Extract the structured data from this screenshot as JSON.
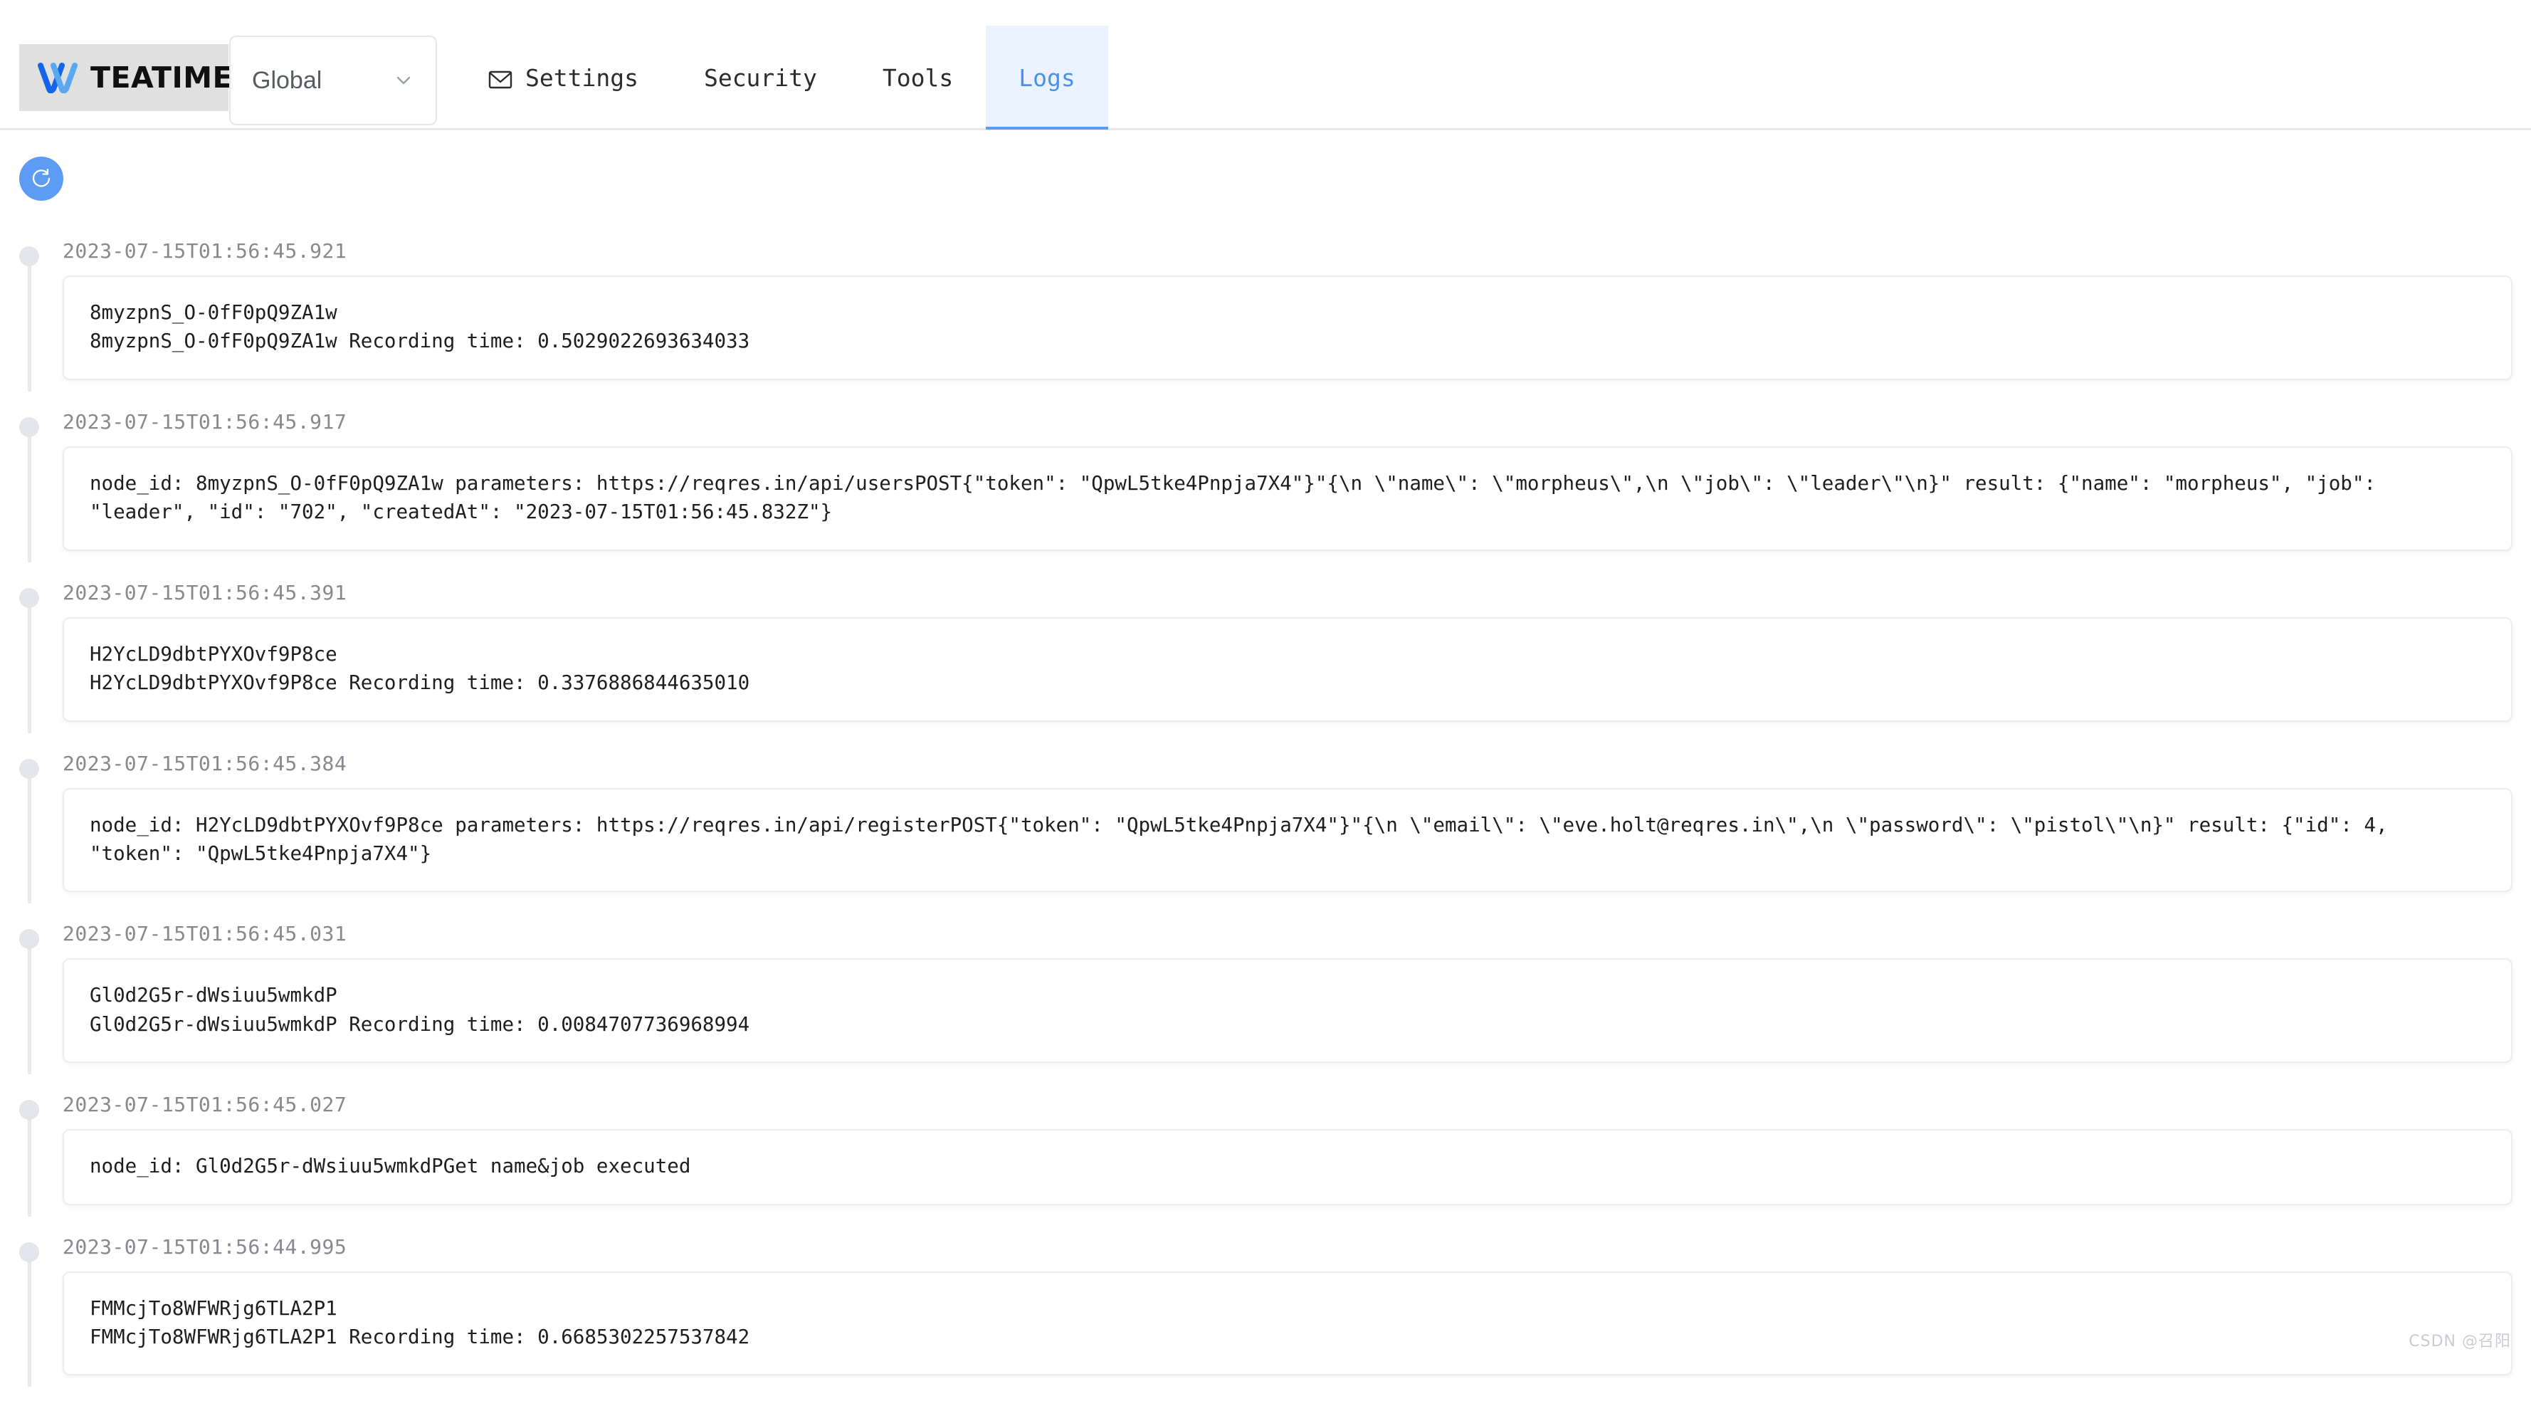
{
  "brand": {
    "name": "TEATIME",
    "logo_icon": "teatime-wave-logo"
  },
  "region_select": {
    "value": "Global",
    "chevron_icon": "chevron-down-icon"
  },
  "tabs": [
    {
      "label": "Settings",
      "icon": "envelope-icon",
      "active": false
    },
    {
      "label": "Security",
      "icon": "",
      "active": false
    },
    {
      "label": "Tools",
      "icon": "",
      "active": false
    },
    {
      "label": "Logs",
      "icon": "",
      "active": true
    }
  ],
  "toolbar": {
    "refresh_icon": "refresh-icon",
    "refresh_label": "Refresh"
  },
  "colors": {
    "accent": "#5c9cf5",
    "active_tab_bg": "#eaf3ff",
    "active_tab_text": "#4a90f0",
    "timeline_dot": "#e3e5ea",
    "brand_bg": "#e0e0e0"
  },
  "logs": [
    {
      "timestamp": "2023-07-15T01:56:45.921",
      "message": "8myzpnS_O-0fF0pQ9ZA1w\n8myzpnS_O-0fF0pQ9ZA1w Recording time: 0.5029022693634033"
    },
    {
      "timestamp": "2023-07-15T01:56:45.917",
      "message": "node_id: 8myzpnS_O-0fF0pQ9ZA1w parameters: https://reqres.in/api/usersPOST{\"token\": \"QpwL5tke4Pnpja7X4\"}\"{\\n \\\"name\\\": \\\"morpheus\\\",\\n \\\"job\\\": \\\"leader\\\"\\n}\" result: {\"name\": \"morpheus\", \"job\": \"leader\", \"id\": \"702\", \"createdAt\": \"2023-07-15T01:56:45.832Z\"}"
    },
    {
      "timestamp": "2023-07-15T01:56:45.391",
      "message": "H2YcLD9dbtPYXOvf9P8ce\nH2YcLD9dbtPYXOvf9P8ce Recording time: 0.3376886844635010"
    },
    {
      "timestamp": "2023-07-15T01:56:45.384",
      "message": "node_id: H2YcLD9dbtPYXOvf9P8ce parameters: https://reqres.in/api/registerPOST{\"token\": \"QpwL5tke4Pnpja7X4\"}\"{\\n \\\"email\\\": \\\"eve.holt@reqres.in\\\",\\n \\\"password\\\": \\\"pistol\\\"\\n}\" result: {\"id\": 4, \"token\": \"QpwL5tke4Pnpja7X4\"}"
    },
    {
      "timestamp": "2023-07-15T01:56:45.031",
      "message": "Gl0d2G5r-dWsiuu5wmkdP\nGl0d2G5r-dWsiuu5wmkdP Recording time: 0.0084707736968994"
    },
    {
      "timestamp": "2023-07-15T01:56:45.027",
      "message": "node_id: Gl0d2G5r-dWsiuu5wmkdPGet name&job executed"
    },
    {
      "timestamp": "2023-07-15T01:56:44.995",
      "message": "FMMcjTo8WFWRjg6TLA2P1\nFMMcjTo8WFWRjg6TLA2P1 Recording time: 0.6685302257537842"
    }
  ],
  "watermark": "CSDN @召阳"
}
